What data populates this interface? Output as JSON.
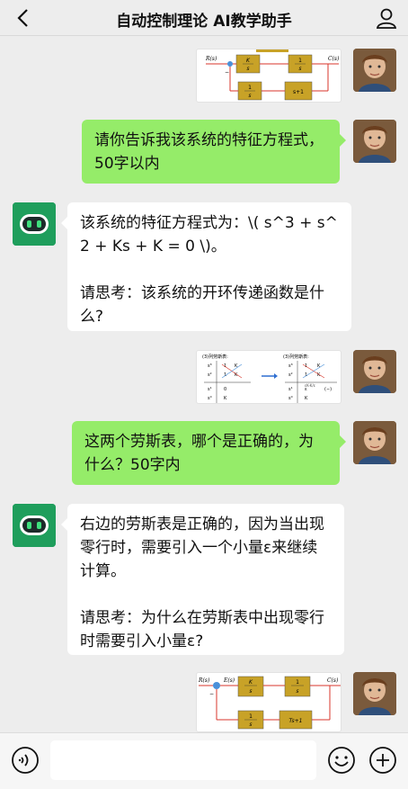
{
  "header": {
    "title": "自动控制理论 AI教学助手",
    "back_icon": "chevron-left-icon",
    "user_icon": "person-icon"
  },
  "messages": [
    {
      "role": "user",
      "type": "image",
      "diagram": {
        "input_label": "R(s)",
        "output_label": "C(s)",
        "minus_sign": "−",
        "block1_num": "K",
        "block1_den": "s",
        "block2_num": "1",
        "block2_den": "s",
        "block3_num": "1",
        "block3_den": "s",
        "block4": "s+1"
      }
    },
    {
      "role": "user",
      "type": "text",
      "text": "请你告诉我该系统的特征方程式，50字以内"
    },
    {
      "role": "assistant",
      "type": "text",
      "paragraphs": [
        "该系统的特征方程式为：\\( s^3 + s^2 + Ks + K = 0 \\)。",
        "请思考：该系统的开环传递函数是什么?"
      ]
    },
    {
      "role": "user",
      "type": "image",
      "routh": {
        "left_title": "(3)列劳斯表:",
        "right_title": "(3)列劳斯表:",
        "rows": [
          "s³",
          "s²",
          "s¹",
          "s⁰"
        ],
        "left_values": [
          "1",
          "1",
          "0",
          "K"
        ],
        "left_values2": [
          "K",
          "K",
          "",
          ""
        ],
        "right_values": [
          "1",
          "1",
          "ε",
          "K"
        ],
        "right_values2": [
          "K",
          "K",
          "",
          ""
        ],
        "right_note": "εK-K/ε",
        "right_sign": "(−)"
      }
    },
    {
      "role": "user",
      "type": "text",
      "text": "这两个劳斯表，哪个是正确的，为什么？50字内"
    },
    {
      "role": "assistant",
      "type": "text",
      "paragraphs": [
        "右边的劳斯表是正确的，因为当出现零行时，需要引入一个小量ε来继续计算。",
        "请思考：为什么在劳斯表中出现零行时需要引入小量ε?"
      ]
    },
    {
      "role": "user",
      "type": "image",
      "diagram": {
        "input_label": "R(s)",
        "output_label": "C(s)",
        "error_label": "E(s)",
        "minus_sign": "−",
        "block1_num": "K",
        "block1_den": "s",
        "block2_num": "1",
        "block2_den": "s",
        "block3_num": "1",
        "block3_den": "s",
        "block4": "Ts+1"
      }
    }
  ],
  "input_bar": {
    "voice_icon": "voice-icon",
    "input_value": "",
    "emoji_icon": "emoji-icon",
    "plus_icon": "plus-icon"
  },
  "colors": {
    "background": "#ededed",
    "user_bubble": "#95ec69",
    "bot_bubble": "#ffffff",
    "bot_avatar": "#1f9e5c",
    "block_fill": "#c8a227",
    "line_red": "#d9362b"
  }
}
